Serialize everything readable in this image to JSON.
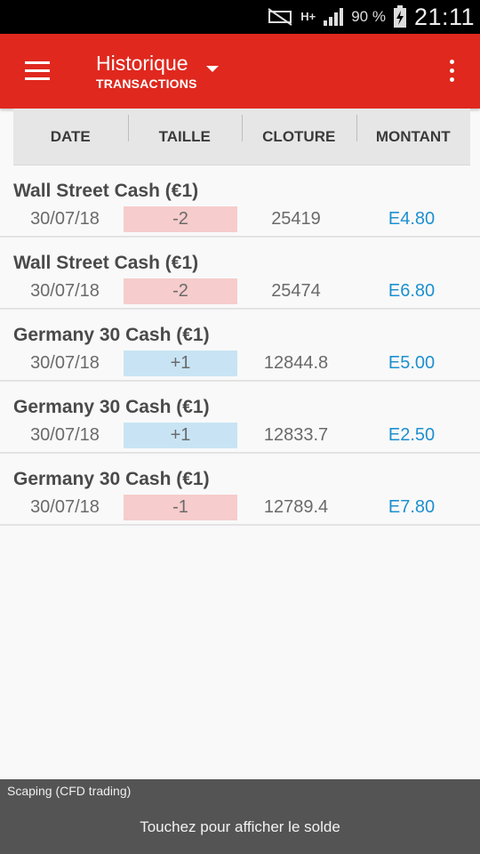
{
  "status_bar": {
    "network": "H+",
    "battery": "90 %",
    "time": "21:11"
  },
  "app_bar": {
    "title": "Historique",
    "subtitle": "TRANSACTIONS",
    "menu_icon": "hamburger-menu-icon",
    "overflow_icon": "more-vert-icon"
  },
  "table": {
    "columns": [
      "DATE",
      "TAILLE",
      "CLOTURE",
      "MONTANT"
    ],
    "rows": [
      {
        "name": "Wall Street Cash (€1)",
        "date": "30/07/18",
        "size": "-2",
        "direction": "neg",
        "close": "25419",
        "amount": "E4.80"
      },
      {
        "name": "Wall Street Cash (€1)",
        "date": "30/07/18",
        "size": "-2",
        "direction": "neg",
        "close": "25474",
        "amount": "E6.80"
      },
      {
        "name": "Germany 30 Cash (€1)",
        "date": "30/07/18",
        "size": "+1",
        "direction": "pos",
        "close": "12844.8",
        "amount": "E5.00"
      },
      {
        "name": "Germany 30 Cash (€1)",
        "date": "30/07/18",
        "size": "+1",
        "direction": "pos",
        "close": "12833.7",
        "amount": "E2.50"
      },
      {
        "name": "Germany 30 Cash (€1)",
        "date": "30/07/18",
        "size": "-1",
        "direction": "neg",
        "close": "12789.4",
        "amount": "E7.80"
      }
    ]
  },
  "footer": {
    "account": "Scaping (CFD trading)",
    "hint": "Touchez pour afficher le solde"
  },
  "colors": {
    "brand_red": "#e0281e",
    "negative_bg": "#f6cccc",
    "positive_bg": "#c8e4f4",
    "amount_blue": "#1e90d0"
  }
}
